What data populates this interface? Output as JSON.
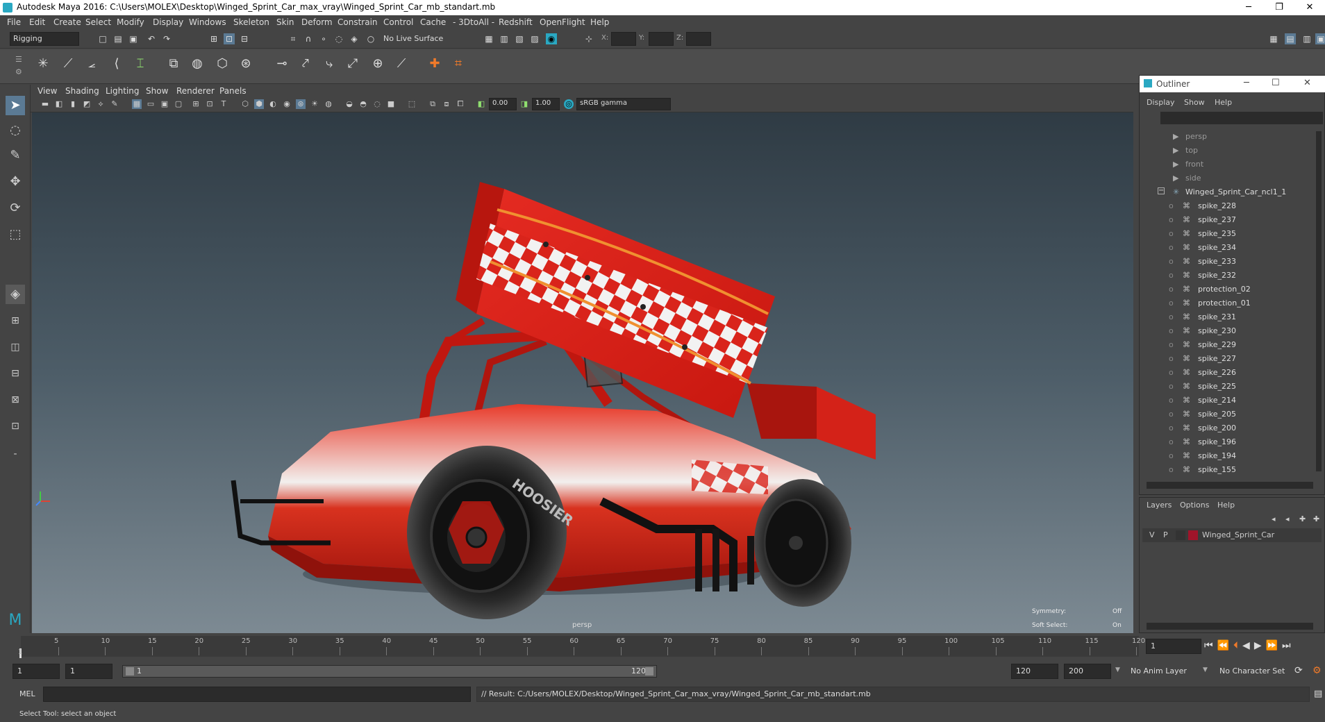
{
  "window": {
    "title": "Autodesk Maya 2016: C:\\Users\\MOLEX\\Desktop\\Winged_Sprint_Car_max_vray\\Winged_Sprint_Car_mb_standart.mb",
    "min": "─",
    "restore": "❐",
    "close": "✕"
  },
  "menu": [
    "File",
    "Edit",
    "Create",
    "Select",
    "Modify",
    "Display",
    "Windows",
    "Skeleton",
    "Skin",
    "Deform",
    "Constrain",
    "Control",
    "Cache",
    "- 3DtoAll -",
    "Redshift",
    "OpenFlight",
    "Help"
  ],
  "status": {
    "mode": "Rigging",
    "live_surface": "No Live Surface",
    "x_label": "X:",
    "y_label": "Y:",
    "z_label": "Z:"
  },
  "viewport": {
    "menu": [
      "View",
      "Shading",
      "Lighting",
      "Show",
      "Renderer",
      "Panels"
    ],
    "exposure": "0.00",
    "gamma": "1.00",
    "color_space": "sRGB gamma",
    "camera": "persp",
    "symmetry_label": "Symmetry:",
    "symmetry_value": "Off",
    "soft_select_label": "Soft Select:",
    "soft_select_value": "On"
  },
  "outliner": {
    "title": "Outliner",
    "menu": [
      "Display",
      "Show",
      "Help"
    ],
    "cameras": [
      "persp",
      "top",
      "front",
      "side"
    ],
    "root": "Winged_Sprint_Car_ncl1_1",
    "children": [
      "spike_228",
      "spike_237",
      "spike_235",
      "spike_234",
      "spike_233",
      "spike_232",
      "protection_02",
      "protection_01",
      "spike_231",
      "spike_230",
      "spike_229",
      "spike_227",
      "spike_226",
      "spike_225",
      "spike_214",
      "spike_205",
      "spike_200",
      "spike_196",
      "spike_194",
      "spike_155"
    ]
  },
  "layers": {
    "menu": [
      "Layers",
      "Options",
      "Help"
    ],
    "v": "V",
    "p": "P",
    "layer_name": "Winged_Sprint_Car",
    "layer_color": "#a0142a"
  },
  "timeline": {
    "ticks": [
      "5",
      "10",
      "15",
      "20",
      "25",
      "30",
      "35",
      "40",
      "45",
      "50",
      "55",
      "60",
      "65",
      "70",
      "75",
      "80",
      "85",
      "90",
      "95",
      "100",
      "105",
      "110",
      "115",
      "120"
    ],
    "start_tick": "1",
    "current_frame": "1"
  },
  "range": {
    "start": "1",
    "start2": "1",
    "slider_start": "1",
    "slider_end": "120",
    "end": "120",
    "end2": "200",
    "anim_layer": "No Anim Layer",
    "char_set": "No Character Set"
  },
  "cmd": {
    "lang": "MEL",
    "result": "// Result: C:/Users/MOLEX/Desktop/Winged_Sprint_Car_max_vray/Winged_Sprint_Car_mb_standart.mb"
  },
  "help": "Select Tool: select an object",
  "car": {
    "wheel_text": "HOOSIER"
  }
}
